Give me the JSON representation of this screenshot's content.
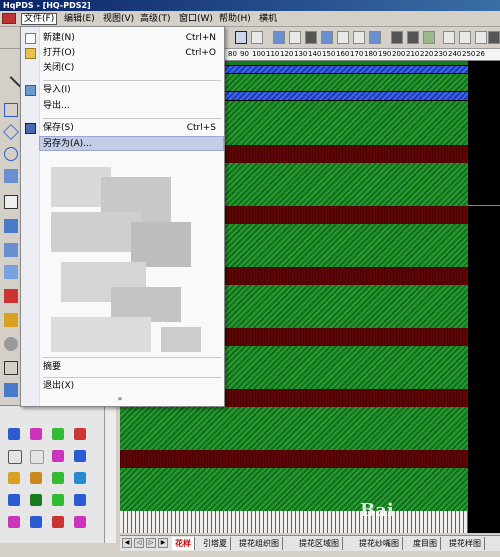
{
  "window": {
    "title": "HqPDS - [HQ-PDS2]"
  },
  "menubar": {
    "items": [
      {
        "label": "文件(F)"
      },
      {
        "label": "编辑(E)"
      },
      {
        "label": "视图(V)"
      },
      {
        "label": "高级(T)"
      },
      {
        "label": "窗口(W)"
      },
      {
        "label": "帮助(H)"
      },
      {
        "label": "横机"
      }
    ]
  },
  "file_menu": {
    "items": [
      {
        "label": "新建(N)",
        "shortcut": "Ctrl+N",
        "icon": "new-file-icon"
      },
      {
        "label": "打开(O)",
        "shortcut": "Ctrl+O",
        "icon": "open-folder-icon"
      },
      {
        "label": "关闭(C)",
        "shortcut": ""
      },
      {
        "label": "导入(I)",
        "shortcut": "",
        "icon": "import-icon"
      },
      {
        "label": "导出...",
        "shortcut": ""
      },
      {
        "label": "保存(S)",
        "shortcut": "Ctrl+S",
        "icon": "save-icon"
      },
      {
        "label": "另存为(A)...",
        "shortcut": "",
        "highlighted": true
      },
      {
        "label": "摘要",
        "shortcut": ""
      },
      {
        "label": "退出(X)",
        "shortcut": ""
      }
    ],
    "expand_glyph": "»"
  },
  "ruler": {
    "ticks": [
      "80",
      "90",
      "100",
      "110",
      "120",
      "130",
      "140",
      "150",
      "160",
      "170",
      "180",
      "190",
      "200",
      "210",
      "220",
      "230",
      "240",
      "250",
      "26"
    ]
  },
  "tabs": {
    "items": [
      "花样",
      "引塔夏",
      "提花组织图",
      "提花区域图",
      "提花纱嘴图",
      "度目图",
      "提花样图"
    ],
    "active_index": 0
  },
  "watermark": {
    "text": "Bai"
  },
  "colors": {
    "knit_green": "#1a8a28",
    "knit_red": "#8a1a1a",
    "knit_blue": "#2a4ed0",
    "menu_highlight": "#c3cde6",
    "title_bar": "#0a246a"
  }
}
